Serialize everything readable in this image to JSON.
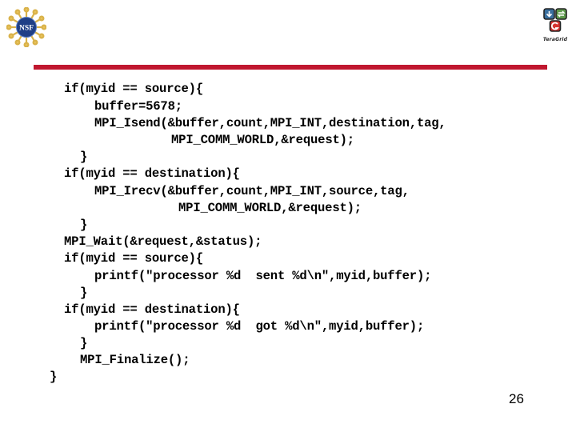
{
  "header": {
    "left_logo": "nsf-logo",
    "left_logo_text": "NSF",
    "right_logo": "teragrid-logo",
    "right_logo_text": "TeraGrid",
    "accent_bar_color": "#c0172f"
  },
  "code": {
    "lines": [
      "if(myid == source){",
      "buffer=5678;",
      "MPI_Isend(&buffer,count,MPI_INT,destination,tag,",
      "MPI_COMM_WORLD,&request);",
      "}",
      "if(myid == destination){",
      "MPI_Irecv(&buffer,count,MPI_INT,source,tag,",
      "MPI_COMM_WORLD,&request);",
      "}",
      "MPI_Wait(&request,&status);",
      "if(myid == source){",
      "printf(\"processor %d  sent %d\\n\",myid,buffer);",
      "}",
      "if(myid == destination){",
      "printf(\"processor %d  got %d\\n\",myid,buffer);",
      "}",
      "MPI_Finalize();",
      "}"
    ]
  },
  "footer": {
    "page_number": "26"
  }
}
